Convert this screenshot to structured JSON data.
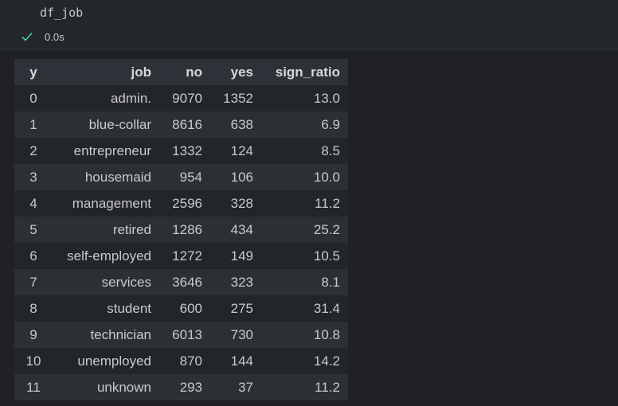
{
  "cell": {
    "code": "df_job",
    "status_icon": "check-icon",
    "status_color": "#4ec9b0",
    "exec_time": "0.0s"
  },
  "table": {
    "columns": [
      "y",
      "job",
      "no",
      "yes",
      "sign_ratio"
    ],
    "rows": [
      {
        "idx": "0",
        "job": "admin.",
        "no": "9070",
        "yes": "1352",
        "sign_ratio": "13.0"
      },
      {
        "idx": "1",
        "job": "blue-collar",
        "no": "8616",
        "yes": "638",
        "sign_ratio": "6.9"
      },
      {
        "idx": "2",
        "job": "entrepreneur",
        "no": "1332",
        "yes": "124",
        "sign_ratio": "8.5"
      },
      {
        "idx": "3",
        "job": "housemaid",
        "no": "954",
        "yes": "106",
        "sign_ratio": "10.0"
      },
      {
        "idx": "4",
        "job": "management",
        "no": "2596",
        "yes": "328",
        "sign_ratio": "11.2"
      },
      {
        "idx": "5",
        "job": "retired",
        "no": "1286",
        "yes": "434",
        "sign_ratio": "25.2"
      },
      {
        "idx": "6",
        "job": "self-employed",
        "no": "1272",
        "yes": "149",
        "sign_ratio": "10.5"
      },
      {
        "idx": "7",
        "job": "services",
        "no": "3646",
        "yes": "323",
        "sign_ratio": "8.1"
      },
      {
        "idx": "8",
        "job": "student",
        "no": "600",
        "yes": "275",
        "sign_ratio": "31.4"
      },
      {
        "idx": "9",
        "job": "technician",
        "no": "6013",
        "yes": "730",
        "sign_ratio": "10.8"
      },
      {
        "idx": "10",
        "job": "unemployed",
        "no": "870",
        "yes": "144",
        "sign_ratio": "14.2"
      },
      {
        "idx": "11",
        "job": "unknown",
        "no": "293",
        "yes": "37",
        "sign_ratio": "11.2"
      }
    ]
  }
}
